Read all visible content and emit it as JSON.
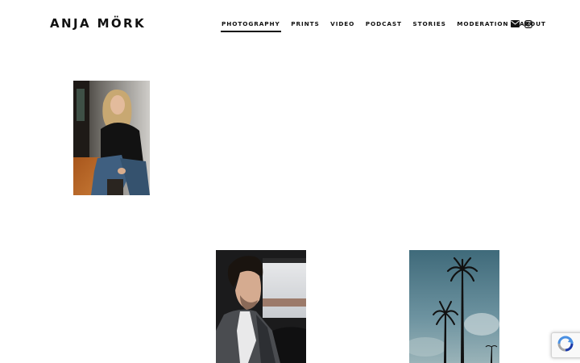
{
  "site": {
    "title": "ANJA MÖRK"
  },
  "nav": {
    "items": [
      {
        "label": "PHOTOGRAPHY",
        "active": true
      },
      {
        "label": "PRINTS",
        "active": false
      },
      {
        "label": "VIDEO",
        "active": false
      },
      {
        "label": "PODCAST",
        "active": false
      },
      {
        "label": "STORIES",
        "active": false
      },
      {
        "label": "MODERATION",
        "active": false
      },
      {
        "label": "ABOUT",
        "active": false
      }
    ],
    "icons": [
      "envelope-icon",
      "instagram-icon"
    ]
  },
  "gallery": {
    "photos": [
      {
        "subject": "portrait-blonde-woman"
      },
      {
        "subject": "portrait-man-in-car"
      },
      {
        "subject": "palm-trees-sky"
      }
    ]
  },
  "widgets": {
    "recaptcha_icon": "recaptcha-icon"
  },
  "colors": {
    "text": "#111111",
    "background": "#ffffff",
    "recaptcha_blue": "#4a90e2"
  }
}
